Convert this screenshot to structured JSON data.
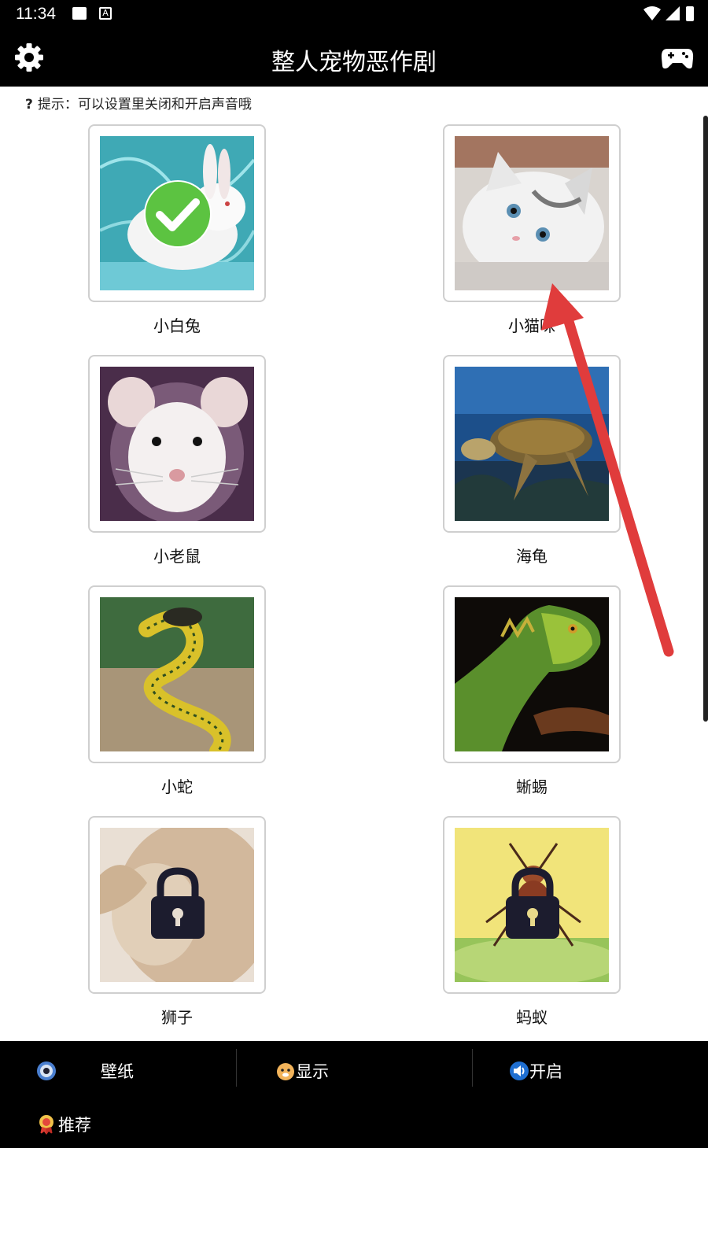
{
  "status": {
    "time": "11:34",
    "a_badge": "A"
  },
  "appbar": {
    "title": "整人宠物恶作剧",
    "left_icon": "gear-icon",
    "right_icon": "gamepad-icon"
  },
  "hint": {
    "icon": "?",
    "text": "提示：可以设置里关闭和开启声音哦"
  },
  "animals": [
    {
      "label": "小白兔",
      "selected": true,
      "locked": false
    },
    {
      "label": "小猫咪",
      "selected": false,
      "locked": false
    },
    {
      "label": "小老鼠",
      "selected": false,
      "locked": false
    },
    {
      "label": "海龟",
      "selected": false,
      "locked": false
    },
    {
      "label": "小蛇",
      "selected": false,
      "locked": false
    },
    {
      "label": "蜥蜴",
      "selected": false,
      "locked": false
    },
    {
      "label": "狮子",
      "selected": false,
      "locked": true
    },
    {
      "label": "蚂蚁",
      "selected": false,
      "locked": true
    }
  ],
  "bottom_nav": {
    "wallpaper": {
      "label": "壁纸",
      "icon": "gear-icon"
    },
    "display": {
      "label": "显示",
      "icon": "dog-icon"
    },
    "sound": {
      "label": "开启",
      "icon": "speaker-icon"
    },
    "recommend": {
      "label": "推荐",
      "icon": "ribbon-icon"
    }
  },
  "colors": {
    "bar_bg": "#000000",
    "arrow": "#e53935",
    "check": "#4caf50"
  }
}
